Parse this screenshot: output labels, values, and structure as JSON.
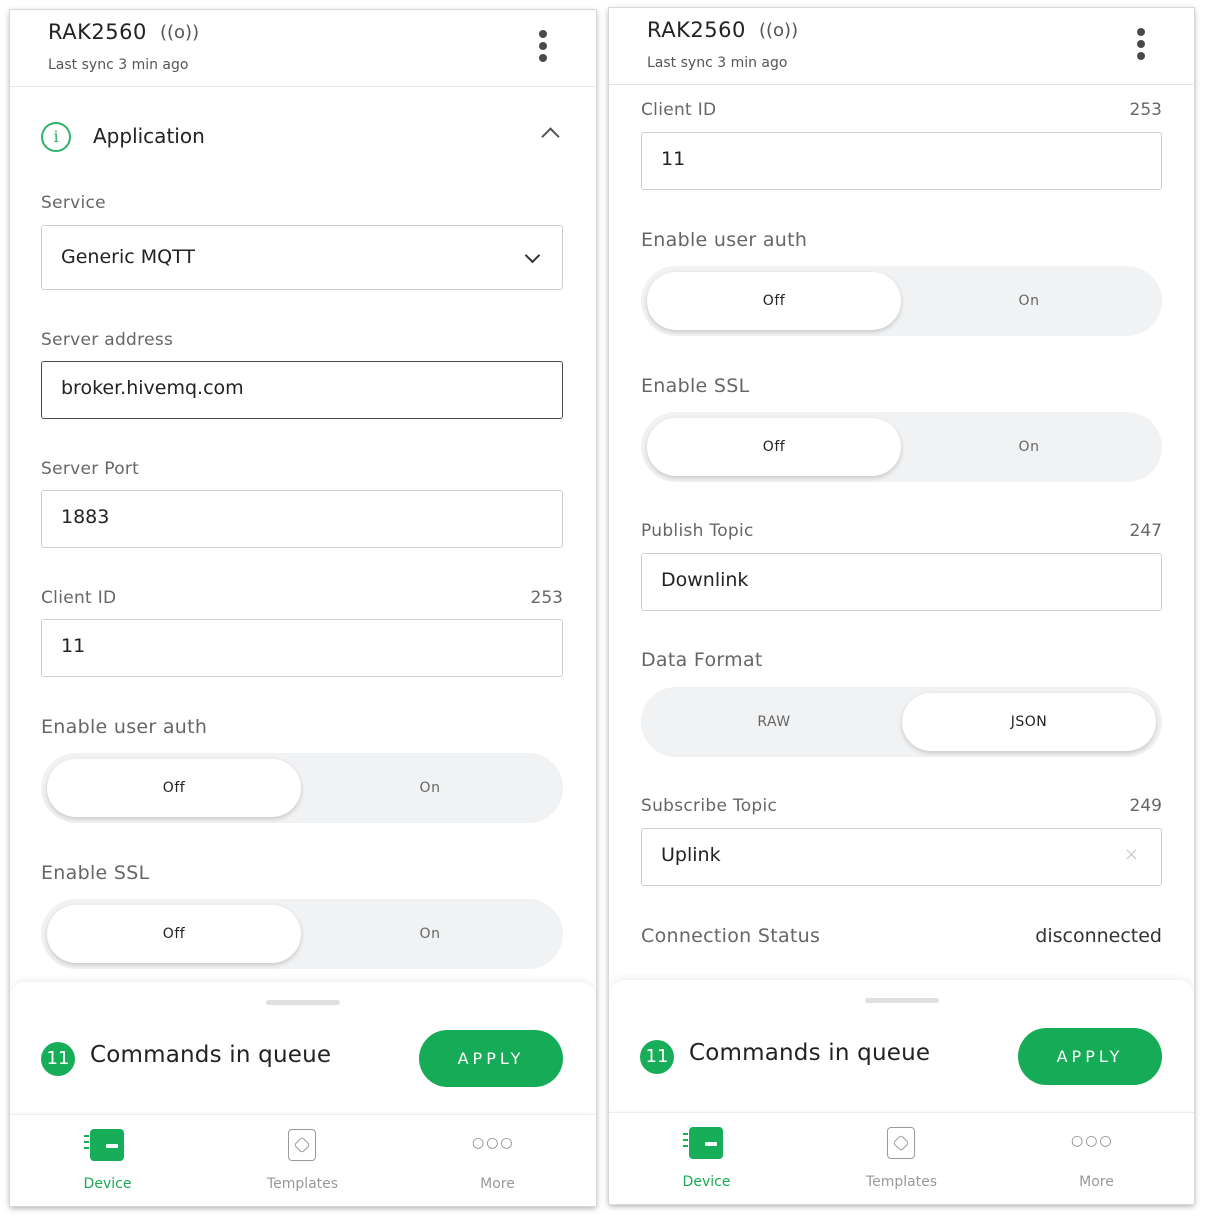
{
  "device": {
    "name": "RAK2560",
    "signal_glyph": "((o))",
    "last_sync": "Last sync 3 min ago"
  },
  "application": {
    "title": "Application",
    "info_glyph": "i"
  },
  "service": {
    "label": "Service",
    "value": "Generic MQTT"
  },
  "server_address": {
    "label": "Server address",
    "value": "broker.hivemq.com"
  },
  "server_port": {
    "label": "Server Port",
    "value": "1883"
  },
  "client_id": {
    "label": "Client ID",
    "value": "11",
    "count": "253"
  },
  "user_auth": {
    "label": "Enable user auth",
    "off": "Off",
    "on": "On",
    "selected": "Off"
  },
  "ssl": {
    "label": "Enable SSL",
    "off": "Off",
    "on": "On",
    "selected": "Off"
  },
  "publish_topic": {
    "label": "Publish Topic",
    "value": "Downlink",
    "count": "247"
  },
  "data_format": {
    "label": "Data Format",
    "raw": "RAW",
    "json": "JSON",
    "selected": "JSON"
  },
  "subscribe_topic": {
    "label": "Subscribe Topic",
    "value": "Uplink",
    "count": "249",
    "clear_glyph": "×"
  },
  "connection_status": {
    "label": "Connection Status",
    "value": "disconnected"
  },
  "queue": {
    "count": "11",
    "text": "Commands in queue",
    "apply_label": "APPLY"
  },
  "nav": {
    "device": "Device",
    "templates": "Templates",
    "more": "More",
    "more_glyph": "○○○",
    "active": "Device"
  },
  "colors": {
    "accent": "#18ad58",
    "text": "#222222",
    "muted": "#666666",
    "toggle_track": "#f1f2f3"
  },
  "icons": [
    "signal-icon",
    "kebab-menu-icon",
    "info-icon",
    "chevron-up-icon",
    "chevron-down-icon",
    "clear-icon",
    "device-icon",
    "templates-icon",
    "more-icon"
  ]
}
